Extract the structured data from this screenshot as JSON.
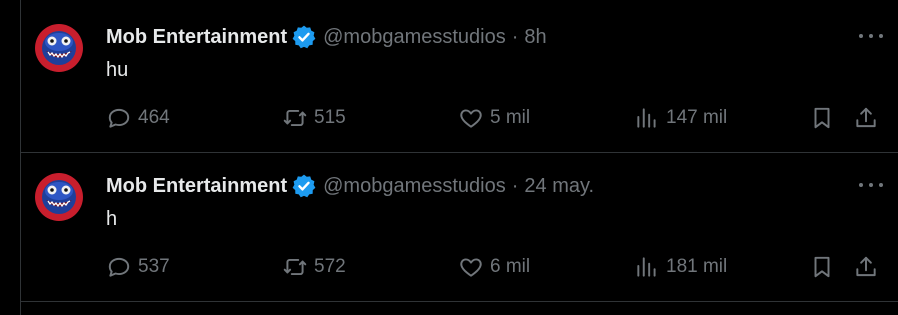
{
  "colors": {
    "background": "#000000",
    "text_primary": "#e7e9ea",
    "text_secondary": "#71767b",
    "divider": "#2f3336",
    "verified_blue": "#1d9bf0"
  },
  "icons": {
    "verified": "verified-badge-icon",
    "more": "more-horizontal-icon",
    "reply": "reply-bubble-icon",
    "retweet": "retweet-icon",
    "like": "heart-icon",
    "views": "views-bar-chart-icon",
    "bookmark": "bookmark-icon",
    "share": "share-upload-icon"
  },
  "tweets": [
    {
      "name": "Mob Entertainment",
      "handle": "@mobgamesstudios",
      "separator": "·",
      "time": "8h",
      "text": "hu",
      "replies": "464",
      "retweets": "515",
      "likes": "5 mil",
      "views": "147 mil"
    },
    {
      "name": "Mob Entertainment",
      "handle": "@mobgamesstudios",
      "separator": "·",
      "time": "24 may.",
      "text": "h",
      "replies": "537",
      "retweets": "572",
      "likes": "6 mil",
      "views": "181 mil"
    }
  ]
}
